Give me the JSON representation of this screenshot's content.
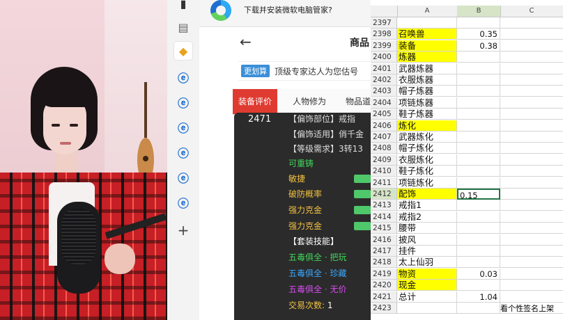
{
  "notification": {
    "text": "下载并安装微软电脑管家?"
  },
  "app": {
    "page_title": "商品",
    "banner": {
      "badge": "更划算",
      "text": "顶级专家达人为您估号"
    },
    "tabs": [
      {
        "label": "装备评价"
      },
      {
        "label": "人物修为"
      },
      {
        "label": "物品道"
      }
    ],
    "detail": {
      "id": "2471",
      "lines": [
        "【偏饰部位】戒指",
        "【偏饰适用】俏千金",
        "【等级需求】3转13"
      ],
      "recast": "可重铸",
      "attrs": [
        "敏捷",
        "破防概率",
        "强力克金",
        "强力克金"
      ],
      "set_skill": "【套装技能】",
      "skills": [
        {
          "text": "五毒俱全 · 把玩",
          "color": "#41d65a"
        },
        {
          "text": "五毒俱全 · 珍藏",
          "color": "#3aa8ff"
        },
        {
          "text": "五毒俱全 · 无价",
          "color": "#d84cf0"
        }
      ],
      "trade_label": "交易次数:",
      "trade_count": "1"
    }
  },
  "spreadsheet": {
    "columns": [
      "A",
      "B",
      "C"
    ],
    "selected_column": "B",
    "rows": [
      {
        "n": "2397",
        "a": "",
        "b": "",
        "y": false
      },
      {
        "n": "2398",
        "a": "召唤兽",
        "b": "0.35",
        "y": true
      },
      {
        "n": "2399",
        "a": "装备",
        "b": "0.38",
        "y": true
      },
      {
        "n": "2400",
        "a": "炼器",
        "b": "",
        "y": true
      },
      {
        "n": "2401",
        "a": "武器炼器",
        "b": "",
        "y": false
      },
      {
        "n": "2402",
        "a": "衣服炼器",
        "b": "",
        "y": false
      },
      {
        "n": "2403",
        "a": "帽子炼器",
        "b": "",
        "y": false
      },
      {
        "n": "2404",
        "a": "项链炼器",
        "b": "",
        "y": false
      },
      {
        "n": "2405",
        "a": "鞋子炼器",
        "b": "",
        "y": false
      },
      {
        "n": "2406",
        "a": "炼化",
        "b": "",
        "y": true
      },
      {
        "n": "2407",
        "a": "武器炼化",
        "b": "",
        "y": false
      },
      {
        "n": "2408",
        "a": "帽子炼化",
        "b": "",
        "y": false
      },
      {
        "n": "2409",
        "a": "衣服炼化",
        "b": "",
        "y": false
      },
      {
        "n": "2410",
        "a": "鞋子炼化",
        "b": "",
        "y": false
      },
      {
        "n": "2411",
        "a": "项链炼化",
        "b": "",
        "y": false
      },
      {
        "n": "2412",
        "a": "配饰",
        "b": "0.15",
        "y": true,
        "editing": true
      },
      {
        "n": "2413",
        "a": "戒指1",
        "b": "",
        "y": false
      },
      {
        "n": "2414",
        "a": "戒指2",
        "b": "",
        "y": false
      },
      {
        "n": "2415",
        "a": "腰带",
        "b": "",
        "y": false
      },
      {
        "n": "2416",
        "a": "披风",
        "b": "",
        "y": false
      },
      {
        "n": "2417",
        "a": "挂件",
        "b": "",
        "y": false
      },
      {
        "n": "2418",
        "a": "太上仙羽",
        "b": "",
        "y": false
      },
      {
        "n": "2419",
        "a": "物资",
        "b": "0.03",
        "y": true
      },
      {
        "n": "2420",
        "a": "现金",
        "b": "",
        "y": true
      },
      {
        "n": "2421",
        "a": "总计",
        "b": "1.04",
        "y": false
      },
      {
        "n": "2423",
        "a": "",
        "b": "",
        "y": false,
        "c": "看个性签名上架"
      }
    ]
  }
}
